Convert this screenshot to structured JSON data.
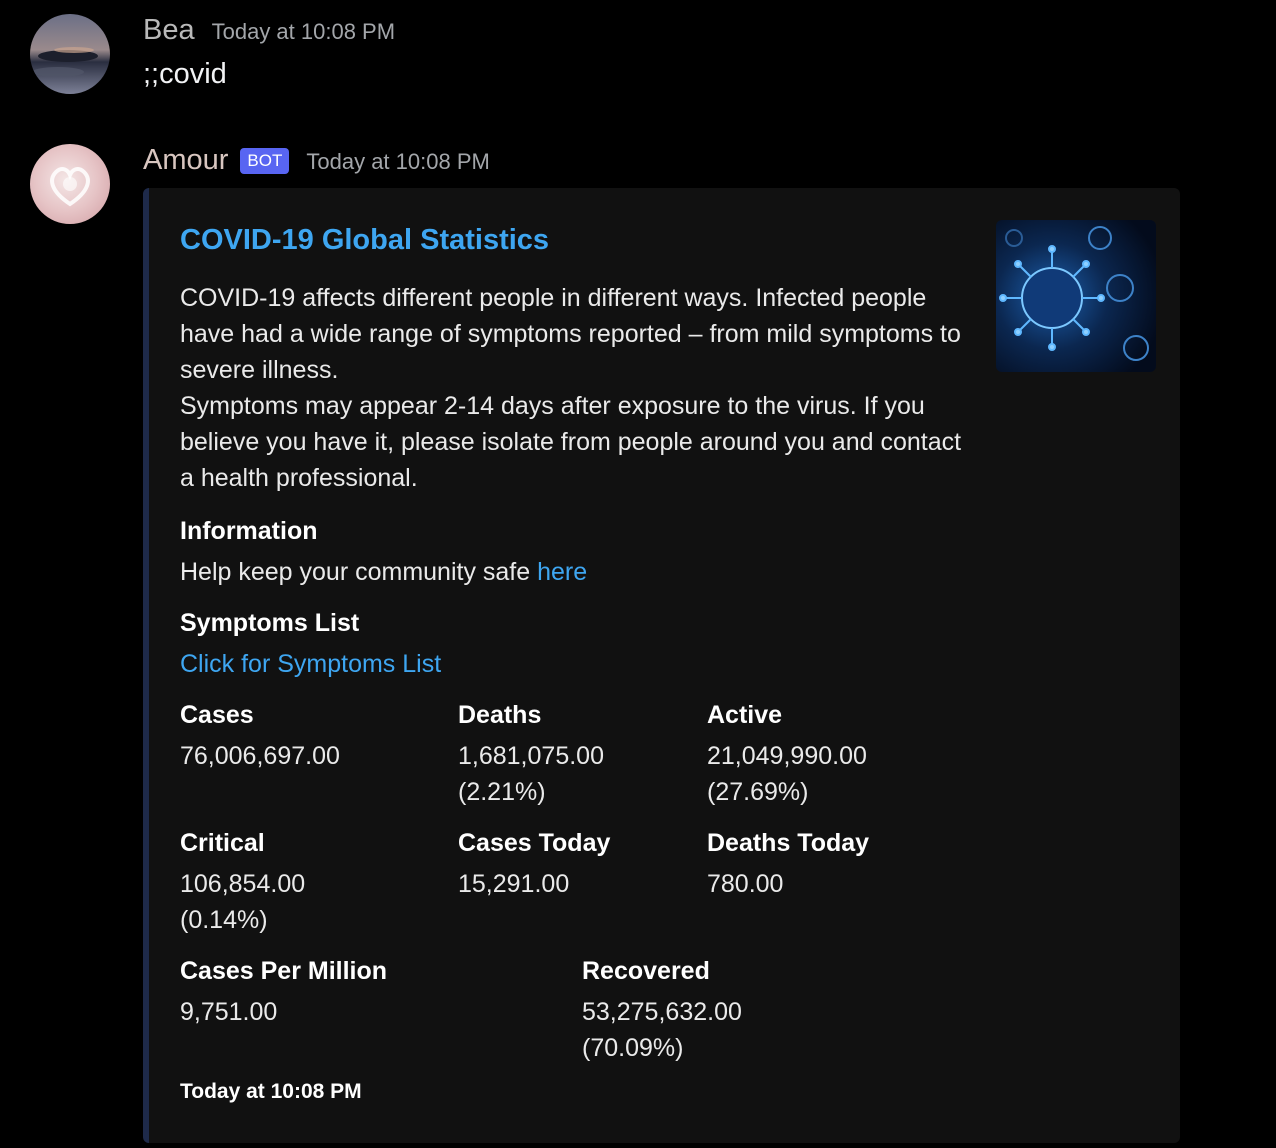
{
  "messages": [
    {
      "username": "Bea",
      "timestamp": "Today at 10:08 PM",
      "content": ";;covid"
    },
    {
      "username": "Amour",
      "bot_tag": "BOT",
      "timestamp": "Today at 10:08 PM",
      "embed": {
        "title": "COVID-19 Global Statistics",
        "description_line1": "COVID-19 affects different people in different ways. Infected people have had a wide range of symptoms reported – from mild symptoms to severe illness.",
        "description_line2": "Symptoms may appear 2-14 days after exposure to the virus. If you believe you have it, please isolate from people around you and contact a health professional.",
        "fields": {
          "information": {
            "name": "Information",
            "text": "Help keep your community safe ",
            "link": "here"
          },
          "symptoms": {
            "name": "Symptoms List",
            "link": "Click for Symptoms List"
          },
          "cases": {
            "name": "Cases",
            "value": "76,006,697.00"
          },
          "deaths": {
            "name": "Deaths",
            "value": "1,681,075.00\n(2.21%)"
          },
          "active": {
            "name": "Active",
            "value": "21,049,990.00\n(27.69%)"
          },
          "critical": {
            "name": "Critical",
            "value": "106,854.00\n(0.14%)"
          },
          "cases_today": {
            "name": "Cases Today",
            "value": "15,291.00"
          },
          "deaths_today": {
            "name": "Deaths Today",
            "value": "780.00"
          },
          "cases_per_million": {
            "name": "Cases Per Million",
            "value": "9,751.00"
          },
          "recovered": {
            "name": "Recovered",
            "value": "53,275,632.00\n(70.09%)"
          }
        },
        "footer": "Today at 10:08 PM",
        "thumbnail_icon": "virus-image"
      }
    }
  ],
  "colors": {
    "background": "#000000",
    "embed_background": "#111111",
    "link": "#3ea6f1",
    "bot_tag": "#5865f2"
  }
}
